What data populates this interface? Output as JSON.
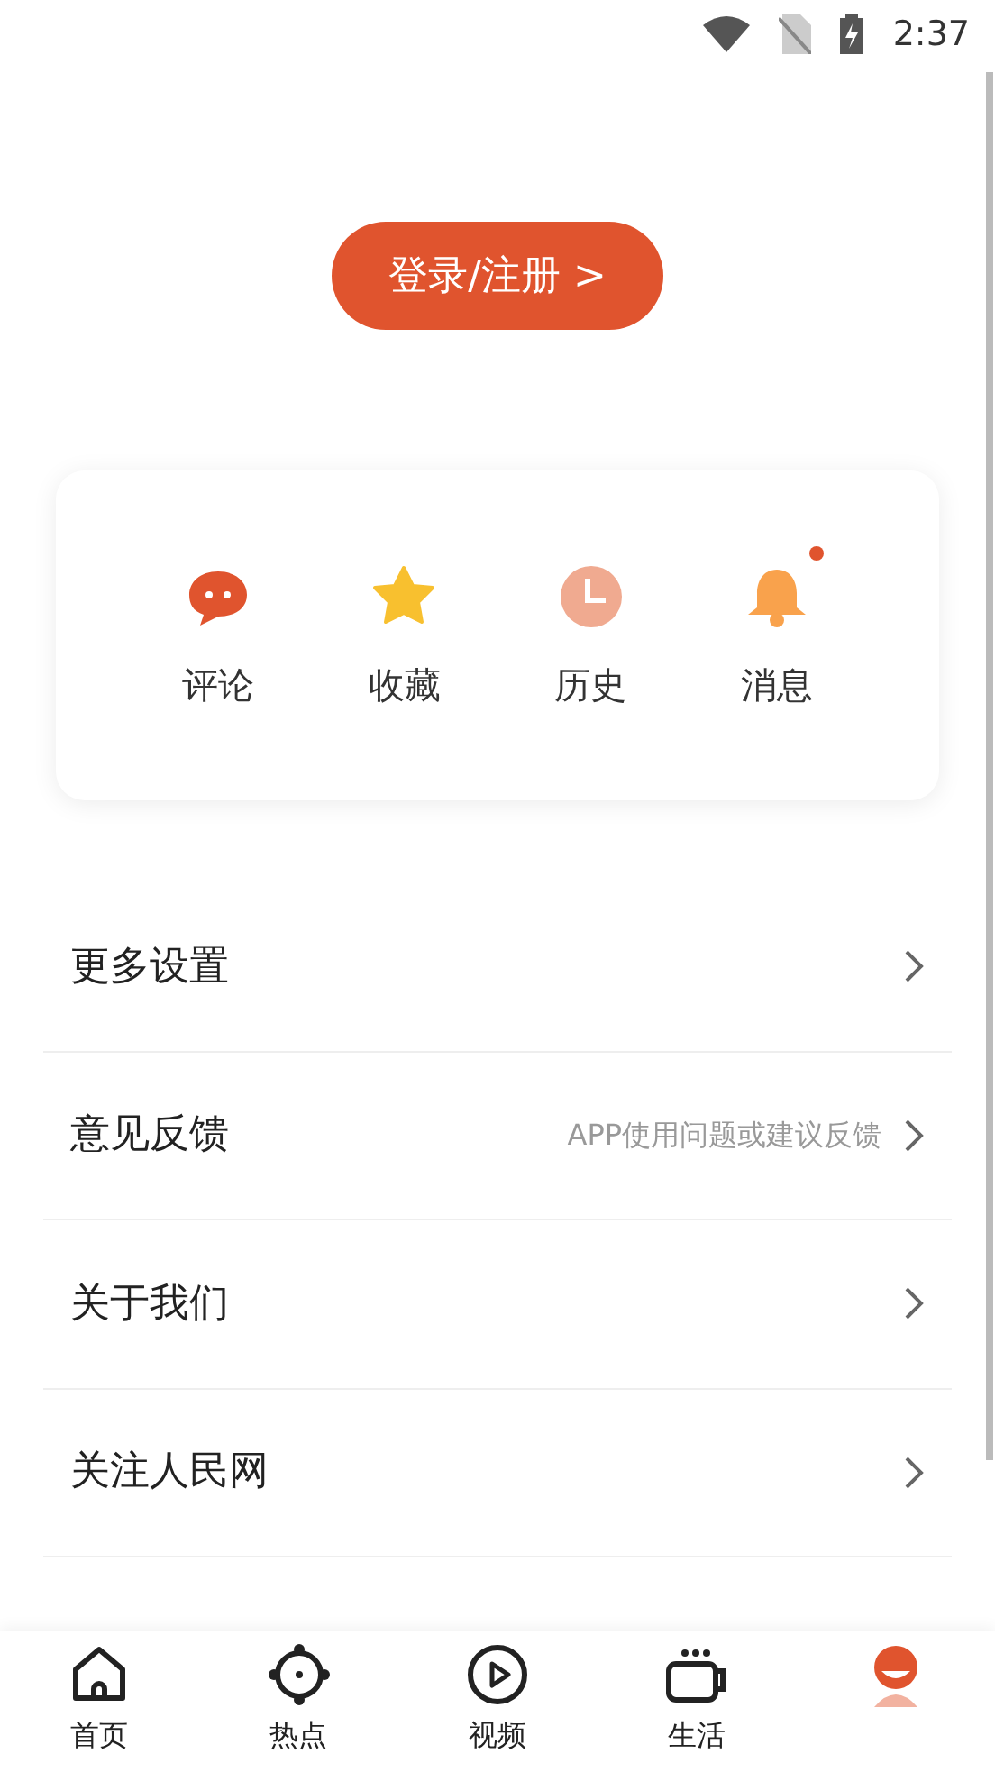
{
  "status_bar": {
    "time": "2:37"
  },
  "login_button": {
    "label": "登录/注册 >"
  },
  "shortcuts": [
    {
      "kind": "comment",
      "label": "评论",
      "badge": false
    },
    {
      "kind": "star",
      "label": "收藏",
      "badge": false
    },
    {
      "kind": "clock",
      "label": "历史",
      "badge": false
    },
    {
      "kind": "bell",
      "label": "消息",
      "badge": true
    }
  ],
  "menu": [
    {
      "label": "更多设置"
    },
    {
      "label": "意见反馈",
      "hint": "APP使用问题或建议反馈"
    },
    {
      "label": "关于我们"
    },
    {
      "label": "关注人民网"
    }
  ],
  "tab_bar": [
    {
      "kind": "home",
      "label": "首页",
      "selected": false
    },
    {
      "kind": "target",
      "label": "热点",
      "selected": false
    },
    {
      "kind": "play",
      "label": "视频",
      "selected": false
    },
    {
      "kind": "cup",
      "label": "生活",
      "selected": false
    },
    {
      "kind": "person",
      "selected": true
    }
  ]
}
